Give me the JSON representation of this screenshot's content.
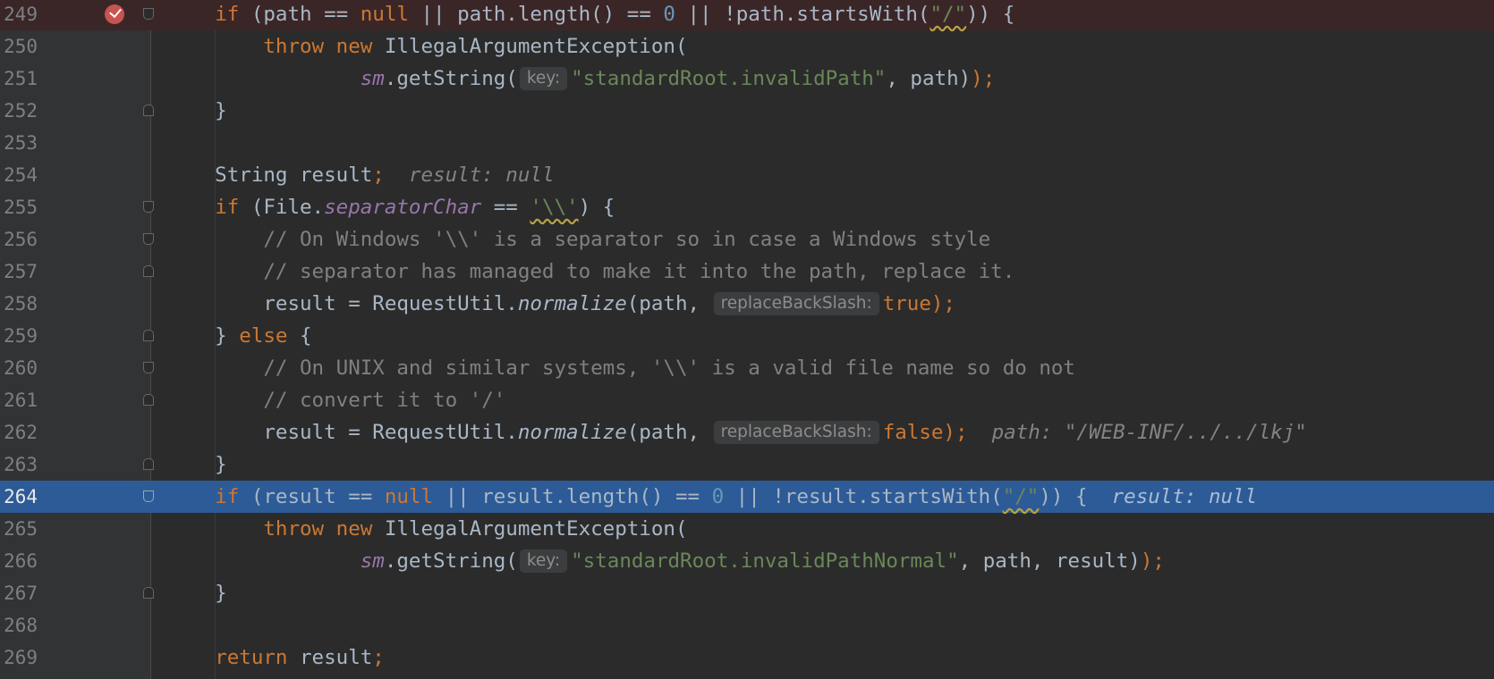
{
  "editor": {
    "breakpoint_line": "249",
    "execution_line": "264",
    "lines": [
      {
        "n": "249",
        "parts": [
          {
            "t": "    "
          },
          {
            "t": "if",
            "c": "kw"
          },
          {
            "t": " (path == "
          },
          {
            "t": "null",
            "c": "kw"
          },
          {
            "t": " || path.length() == "
          },
          {
            "t": "0",
            "c": "num"
          },
          {
            "t": " || !path.startsWith("
          },
          {
            "t": "\"/\"",
            "c": "str squig"
          },
          {
            "t": ")) {"
          }
        ]
      },
      {
        "n": "250",
        "parts": [
          {
            "t": "        "
          },
          {
            "t": "throw new",
            "c": "kw"
          },
          {
            "t": " IllegalArgumentException("
          }
        ]
      },
      {
        "n": "251",
        "parts": [
          {
            "t": "                "
          },
          {
            "t": "sm",
            "c": "fld"
          },
          {
            "t": ".getString("
          },
          {
            "t": "key:",
            "c": "hint"
          },
          {
            "t": "\"standardRoot.invalidPath\"",
            "c": "str"
          },
          {
            "t": ", path)",
            "c": ""
          },
          {
            "t": ");",
            "c": "kw"
          }
        ]
      },
      {
        "n": "252",
        "parts": [
          {
            "t": "    }"
          }
        ]
      },
      {
        "n": "253",
        "parts": []
      },
      {
        "n": "254",
        "parts": [
          {
            "t": "    String result"
          },
          {
            "t": ";",
            "c": "kw"
          },
          {
            "t": "  "
          },
          {
            "t": "result: null",
            "c": "inl"
          }
        ]
      },
      {
        "n": "255",
        "parts": [
          {
            "t": "    "
          },
          {
            "t": "if",
            "c": "kw"
          },
          {
            "t": " (File."
          },
          {
            "t": "separatorChar",
            "c": "fld"
          },
          {
            "t": " == "
          },
          {
            "t": "'\\\\'",
            "c": "str squig"
          },
          {
            "t": ") {"
          }
        ]
      },
      {
        "n": "256",
        "parts": [
          {
            "t": "        "
          },
          {
            "t": "// On Windows '\\\\' is a separator so in case a Windows style",
            "c": "cmt"
          }
        ]
      },
      {
        "n": "257",
        "parts": [
          {
            "t": "        "
          },
          {
            "t": "// separator has managed to make it into the path, replace it.",
            "c": "cmt"
          }
        ]
      },
      {
        "n": "258",
        "parts": [
          {
            "t": "        result = RequestUtil."
          },
          {
            "t": "normalize",
            "c": "ita"
          },
          {
            "t": "(path, "
          },
          {
            "t": "replaceBackSlash:",
            "c": "hint"
          },
          {
            "t": "true",
            "c": "kw"
          },
          {
            "t": ");",
            "c": "kw"
          }
        ]
      },
      {
        "n": "259",
        "parts": [
          {
            "t": "    } "
          },
          {
            "t": "else",
            "c": "kw"
          },
          {
            "t": " {"
          }
        ]
      },
      {
        "n": "260",
        "parts": [
          {
            "t": "        "
          },
          {
            "t": "// On UNIX and similar systems, '\\\\' is a valid file name so do not",
            "c": "cmt"
          }
        ]
      },
      {
        "n": "261",
        "parts": [
          {
            "t": "        "
          },
          {
            "t": "// convert it to '/'",
            "c": "cmt"
          }
        ]
      },
      {
        "n": "262",
        "parts": [
          {
            "t": "        result = RequestUtil."
          },
          {
            "t": "normalize",
            "c": "ita"
          },
          {
            "t": "(path, "
          },
          {
            "t": "replaceBackSlash:",
            "c": "hint"
          },
          {
            "t": "false",
            "c": "kw"
          },
          {
            "t": ");",
            "c": "kw"
          },
          {
            "t": "  "
          },
          {
            "t": "path: \"/WEB-INF/../../lkj\"",
            "c": "inl"
          }
        ]
      },
      {
        "n": "263",
        "parts": [
          {
            "t": "    }"
          }
        ]
      },
      {
        "n": "264",
        "parts": [
          {
            "t": "    "
          },
          {
            "t": "if",
            "c": "kw"
          },
          {
            "t": " (result == "
          },
          {
            "t": "null",
            "c": "kw"
          },
          {
            "t": " || result.length() == "
          },
          {
            "t": "0",
            "c": "num"
          },
          {
            "t": " || !result.startsWith("
          },
          {
            "t": "\"/\"",
            "c": "str squig"
          },
          {
            "t": ")) {"
          },
          {
            "t": "  "
          },
          {
            "t": "result: null",
            "c": "inl"
          }
        ]
      },
      {
        "n": "265",
        "parts": [
          {
            "t": "        "
          },
          {
            "t": "throw new",
            "c": "kw"
          },
          {
            "t": " IllegalArgumentException("
          }
        ]
      },
      {
        "n": "266",
        "parts": [
          {
            "t": "                "
          },
          {
            "t": "sm",
            "c": "fld"
          },
          {
            "t": ".getString("
          },
          {
            "t": "key:",
            "c": "hint"
          },
          {
            "t": "\"standardRoot.invalidPathNormal\"",
            "c": "str"
          },
          {
            "t": ", path, result)"
          },
          {
            "t": ");",
            "c": "kw"
          }
        ]
      },
      {
        "n": "267",
        "parts": [
          {
            "t": "    }"
          }
        ]
      },
      {
        "n": "268",
        "parts": []
      },
      {
        "n": "269",
        "parts": [
          {
            "t": "    "
          },
          {
            "t": "return",
            "c": "kw"
          },
          {
            "t": " result"
          },
          {
            "t": ";",
            "c": "kw"
          }
        ]
      }
    ],
    "folds": {
      "249": "open",
      "252": "close",
      "255": "open",
      "256": "open",
      "257": "close",
      "259": "close",
      "260": "open",
      "261": "close",
      "263": "close",
      "264": "open",
      "267": "close"
    }
  }
}
